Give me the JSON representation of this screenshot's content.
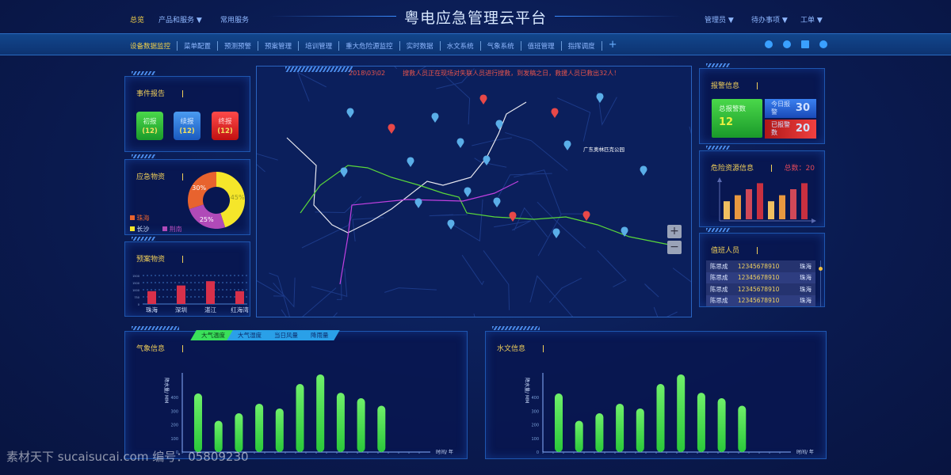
{
  "header": {
    "title": "粤电应急管理云平台",
    "left_nav": [
      "总览",
      "产品和服务 ▼",
      "常用服务"
    ],
    "right_nav": [
      "管理员 ▼",
      "待办事项 ▼",
      "工单 ▼"
    ]
  },
  "navbar": {
    "items": [
      "设备数据监控",
      "菜单配置",
      "预测预警",
      "预案管理",
      "培训管理",
      "重大危险源监控",
      "实时数据",
      "水文系统",
      "气象系统",
      "值班管理",
      "指挥调度"
    ],
    "add": "+",
    "icons": [
      "clock-icon",
      "help-icon",
      "mail-icon",
      "gear-icon"
    ]
  },
  "event_report": {
    "title": "事件报告",
    "buttons": [
      {
        "label": "初报",
        "count": "(12)",
        "color": "#2bb536"
      },
      {
        "label": "续报",
        "count": "(12)",
        "color": "#2e7ad8"
      },
      {
        "label": "终报",
        "count": "(12)",
        "color": "#e2242a"
      }
    ]
  },
  "emergency_supplies": {
    "title": "应急物资",
    "legend": [
      "珠海",
      "长沙",
      "荆南"
    ],
    "chart_data": {
      "type": "pie",
      "labels": [
        "珠海",
        "长沙",
        "荆南"
      ],
      "values": [
        30,
        45,
        25
      ],
      "value_labels": [
        "30%",
        "45%",
        "25%"
      ],
      "colors": [
        "#e8632e",
        "#f5e62a",
        "#b04ab8"
      ]
    }
  },
  "plan_supplies": {
    "title": "预案物资",
    "chart_data": {
      "type": "bar",
      "categories": [
        "珠海",
        "深圳",
        "湛江",
        "红海湾"
      ],
      "values": [
        900,
        1300,
        1600,
        900
      ],
      "yticks": [
        "0",
        "750",
        "1000",
        "1500",
        "1500"
      ],
      "color": "#d8304a"
    }
  },
  "map": {
    "date": "2018\\03\\02",
    "message": "搜救人员正在现场对失联人员进行搜救，到发稿之日，救援人员已救出32人！",
    "place_label": "广东奥林匹克公园",
    "zoom_in": "+",
    "zoom_out": "−"
  },
  "alarm_info": {
    "title": "报警信息",
    "total_label": "总报警数",
    "total": "12",
    "today_label": "今日报警",
    "today": "30",
    "reported_label": "已报警数",
    "reported": "20"
  },
  "hazard": {
    "title": "危险资源信息",
    "total": "总数：20",
    "chart_data": {
      "type": "bar",
      "values": [
        3,
        4,
        5,
        6,
        3,
        4,
        5,
        6
      ],
      "colors": [
        "#f0c060",
        "#e89840",
        "#d04858",
        "#c83040",
        "#f0c060",
        "#e89840",
        "#d04858",
        "#c83040"
      ]
    }
  },
  "duty": {
    "title": "值班人员",
    "rows": [
      [
        "陈思成",
        "12345678910",
        "珠海"
      ],
      [
        "陈思成",
        "12345678910",
        "珠海"
      ],
      [
        "陈思成",
        "12345678910",
        "珠海"
      ],
      [
        "陈思成",
        "12345678910",
        "珠海"
      ]
    ]
  },
  "weather": {
    "title": "气象信息",
    "tabs": [
      "大气温度",
      "大气湿度",
      "当日风量",
      "降雨量"
    ],
    "chart_data": {
      "type": "bar",
      "ylabel": "降水量/ MM",
      "xlabel": "时间/ 年",
      "yticks": [
        0,
        100,
        200,
        300,
        400
      ],
      "values": [
        430,
        230,
        285,
        355,
        320,
        500,
        570,
        435,
        395,
        340
      ],
      "color": "#3ee04a"
    }
  },
  "hydro": {
    "title": "水文信息",
    "chart_data": {
      "type": "bar",
      "ylabel": "降水量/ MM",
      "xlabel": "时间/ 年",
      "yticks": [
        0,
        100,
        200,
        300,
        400
      ],
      "values": [
        430,
        230,
        285,
        355,
        320,
        500,
        570,
        435,
        395,
        340
      ],
      "color": "#3ee04a"
    }
  },
  "watermark": "素材天下 sucaisucai.com  编号：05809230"
}
